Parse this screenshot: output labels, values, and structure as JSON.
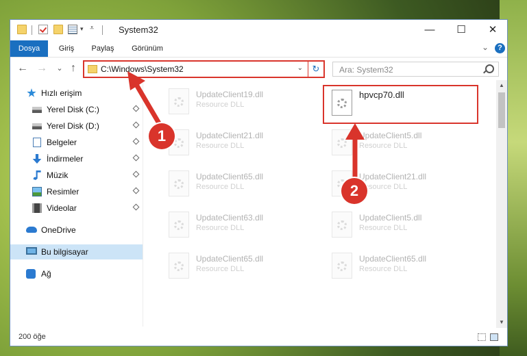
{
  "window": {
    "title": "System32",
    "minimize": "—",
    "maximize": "☐",
    "close": "✕"
  },
  "ribbon": {
    "tabs": [
      "Dosya",
      "Giriş",
      "Paylaş",
      "Görünüm"
    ],
    "collapse": "⌄",
    "help": "?"
  },
  "nav": {
    "back": "←",
    "forward": "→",
    "recent": "⌄",
    "up": "↑"
  },
  "address": {
    "path": "C:\\Windows\\System32",
    "dropdown": "⌄",
    "refresh": "↻"
  },
  "search": {
    "placeholder": "Ara: System32"
  },
  "sidebar": {
    "items": [
      {
        "label": "Hızlı erişim"
      },
      {
        "label": "Yerel Disk (C:)"
      },
      {
        "label": "Yerel Disk (D:)"
      },
      {
        "label": "Belgeler"
      },
      {
        "label": "İndirmeler"
      },
      {
        "label": "Müzik"
      },
      {
        "label": "Resimler"
      },
      {
        "label": "Videolar"
      },
      {
        "label": "OneDrive"
      },
      {
        "label": "Bu bilgisayar"
      },
      {
        "label": "Ağ"
      }
    ]
  },
  "files": {
    "highlighted": {
      "name": "hpvcp70.dll",
      "type": ""
    },
    "left": [
      {
        "name": "UpdateClient19.dll",
        "type": "Resource DLL"
      },
      {
        "name": "UpdateClient21.dll",
        "type": "Resource DLL"
      },
      {
        "name": "UpdateClient65.dll",
        "type": "Resource DLL"
      },
      {
        "name": "UpdateClient63.dll",
        "type": "Resource DLL"
      },
      {
        "name": "UpdateClient65.dll",
        "type": "Resource DLL"
      }
    ],
    "right": [
      {
        "name": "UpdateClient5.dll",
        "type": "Resource DLL"
      },
      {
        "name": "UpdateClient21.dll",
        "type": "Resource DLL"
      },
      {
        "name": "UpdateClient5.dll",
        "type": "Resource DLL"
      },
      {
        "name": "UpdateClient65.dll",
        "type": "Resource DLL"
      }
    ]
  },
  "status": {
    "count": "200 öğe"
  },
  "annotations": {
    "one": "1",
    "two": "2",
    "color": "#d9342b"
  }
}
